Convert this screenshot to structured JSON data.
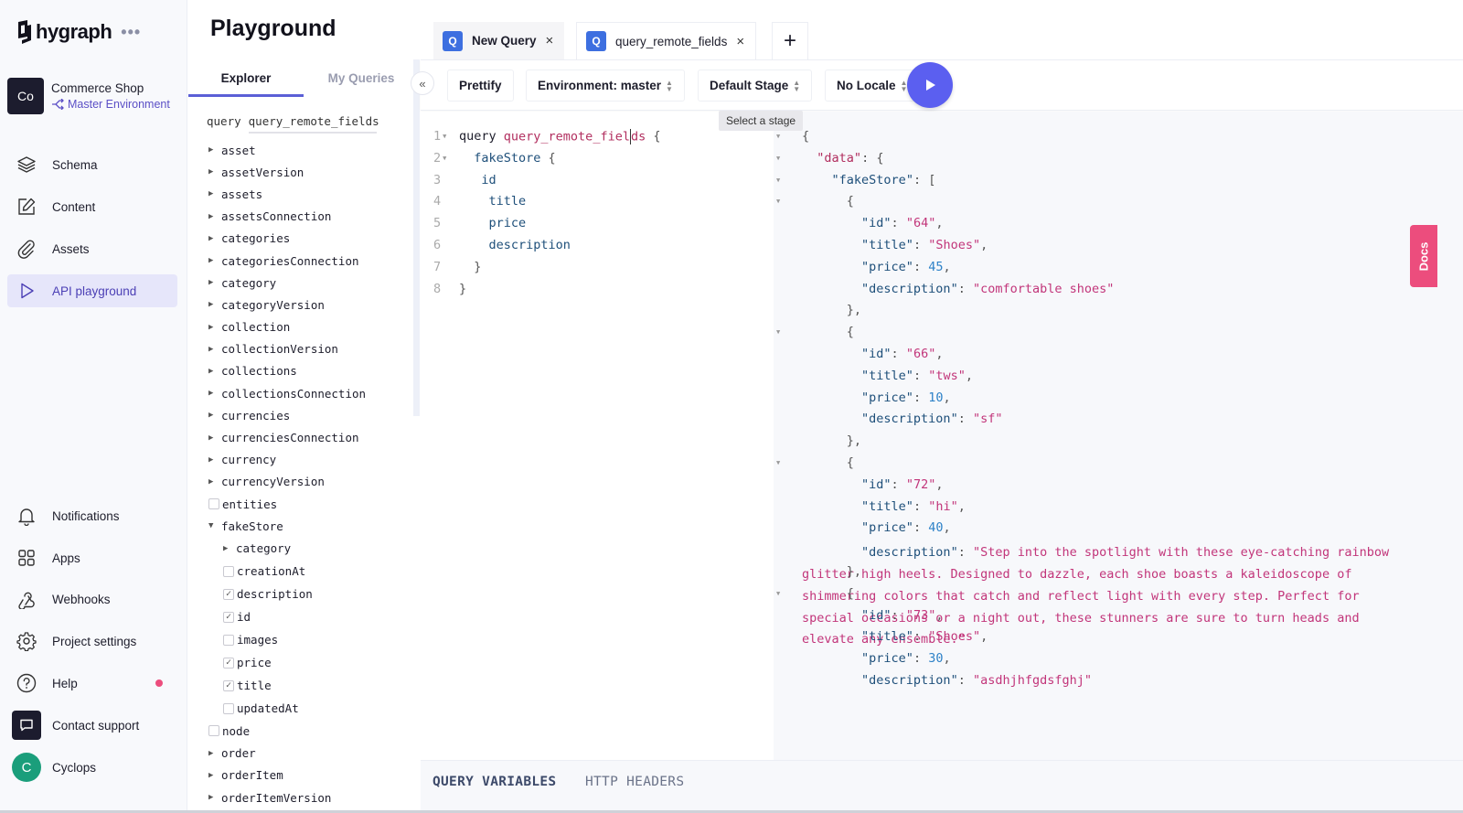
{
  "app": {
    "brand": "hygraph",
    "more_label": "•••",
    "project": {
      "avatar_initials": "Co",
      "name": "Commerce Shop",
      "environment": "Master Environment"
    },
    "nav": {
      "main": [
        {
          "label": "Schema",
          "icon": "layers-icon"
        },
        {
          "label": "Content",
          "icon": "edit-icon"
        },
        {
          "label": "Assets",
          "icon": "paperclip-icon"
        },
        {
          "label": "API playground",
          "icon": "play-icon",
          "active": true
        }
      ],
      "bottom": [
        {
          "label": "Notifications",
          "icon": "bell-icon"
        },
        {
          "label": "Apps",
          "icon": "grid-icon"
        },
        {
          "label": "Webhooks",
          "icon": "webhook-icon"
        },
        {
          "label": "Project settings",
          "icon": "gear-icon"
        },
        {
          "label": "Help",
          "icon": "help-icon",
          "badge_color": "#ec4d7d"
        },
        {
          "label": "Contact support",
          "icon": "chat-icon"
        },
        {
          "label": "Cyclops",
          "icon": "user-avatar",
          "avatar_initial": "C"
        }
      ]
    }
  },
  "explorer": {
    "title": "Playground",
    "tabs": [
      "Explorer",
      "My Queries"
    ],
    "active_tab": "Explorer",
    "query_keyword": "query",
    "query_name": "query_remote_fields",
    "tree": [
      {
        "label": "asset",
        "type": "expandable"
      },
      {
        "label": "assetVersion",
        "type": "expandable"
      },
      {
        "label": "assets",
        "type": "expandable"
      },
      {
        "label": "assetsConnection",
        "type": "expandable"
      },
      {
        "label": "categories",
        "type": "expandable"
      },
      {
        "label": "categoriesConnection",
        "type": "expandable"
      },
      {
        "label": "category",
        "type": "expandable"
      },
      {
        "label": "categoryVersion",
        "type": "expandable"
      },
      {
        "label": "collection",
        "type": "expandable"
      },
      {
        "label": "collectionVersion",
        "type": "expandable"
      },
      {
        "label": "collections",
        "type": "expandable"
      },
      {
        "label": "collectionsConnection",
        "type": "expandable"
      },
      {
        "label": "currencies",
        "type": "expandable"
      },
      {
        "label": "currenciesConnection",
        "type": "expandable"
      },
      {
        "label": "currency",
        "type": "expandable"
      },
      {
        "label": "currencyVersion",
        "type": "expandable"
      },
      {
        "label": "entities",
        "type": "checkbox",
        "checked": false
      },
      {
        "label": "fakeStore",
        "type": "expanded",
        "children": [
          {
            "label": "category",
            "type": "expandable"
          },
          {
            "label": "creationAt",
            "type": "checkbox",
            "checked": false
          },
          {
            "label": "description",
            "type": "checkbox",
            "checked": true
          },
          {
            "label": "id",
            "type": "checkbox",
            "checked": true
          },
          {
            "label": "images",
            "type": "checkbox",
            "checked": false
          },
          {
            "label": "price",
            "type": "checkbox",
            "checked": true
          },
          {
            "label": "title",
            "type": "checkbox",
            "checked": true
          },
          {
            "label": "updatedAt",
            "type": "checkbox",
            "checked": false
          }
        ]
      },
      {
        "label": "node",
        "type": "checkbox",
        "checked": false
      },
      {
        "label": "order",
        "type": "expandable"
      },
      {
        "label": "orderItem",
        "type": "expandable"
      },
      {
        "label": "orderItemVersion",
        "type": "expandable"
      }
    ]
  },
  "tabs": [
    {
      "badge": "Q",
      "label": "New Query",
      "close": "×"
    },
    {
      "badge": "Q",
      "label": "query_remote_fields",
      "close": "×",
      "active": true
    }
  ],
  "add_tab_label": "+",
  "toolbar": {
    "prettify": "Prettify",
    "environment": "Environment: master",
    "stage": "Default Stage",
    "locale": "No Locale",
    "run_label": "Run query",
    "tooltip": "Select a stage"
  },
  "query_editor": {
    "lines": [
      {
        "n": "1",
        "fold": true
      },
      {
        "n": "2",
        "fold": true
      },
      {
        "n": "3"
      },
      {
        "n": "4"
      },
      {
        "n": "5"
      },
      {
        "n": "6"
      },
      {
        "n": "7"
      },
      {
        "n": "8"
      }
    ],
    "keyword": "query",
    "name": "query_remote_fields",
    "root_field": "fakeStore",
    "fields": [
      "id",
      "title",
      "price",
      "description"
    ]
  },
  "result": {
    "root_key": "data",
    "list_key": "fakeStore",
    "items": [
      {
        "id": "64",
        "title": "Shoes",
        "price": "45",
        "description": "comfortable shoes"
      },
      {
        "id": "66",
        "title": "tws",
        "price": "10",
        "description": "sf"
      },
      {
        "id": "72",
        "title": "hi",
        "price": "40",
        "description": "Step into the spotlight with these eye-catching rainbow glitter high heels. Designed to dazzle, each shoe boasts a kaleidoscope of shimmering colors that catch and reflect light with every step. Perfect for special occasions or a night out, these stunners are sure to turn heads and elevate any ensemble."
      },
      {
        "id": "73",
        "title": "Shoes",
        "price": "30",
        "description": "asdhjhfgdsfghj"
      }
    ]
  },
  "docs_label": "Docs",
  "bottom_tabs": [
    "QUERY VARIABLES",
    "HTTP HEADERS"
  ],
  "colors": {
    "accent": "#5b5ff0",
    "active_nav_bg": "#e6e6fa",
    "docs": "#ec4d7d",
    "string": "#c2357a",
    "number": "#2e82c8",
    "key": "#1e4f7a"
  }
}
